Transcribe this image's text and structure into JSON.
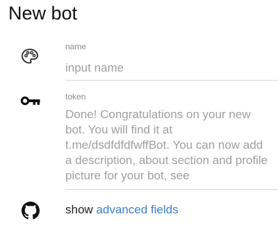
{
  "header": {
    "title": "New bot"
  },
  "name_field": {
    "label": "name",
    "placeholder": "input name",
    "value": "",
    "icon": "palette-icon"
  },
  "token_field": {
    "label": "token",
    "value": "Done! Congratulations on your new bot. You will find it at t.me/dsdfdfdfwffBot. You can now add a description, about section and profile picture for your bot, see",
    "icon": "key-icon"
  },
  "advanced": {
    "prefix": "show",
    "link_text": "advanced fields",
    "icon": "github-icon",
    "link_color": "#3d7dca"
  }
}
